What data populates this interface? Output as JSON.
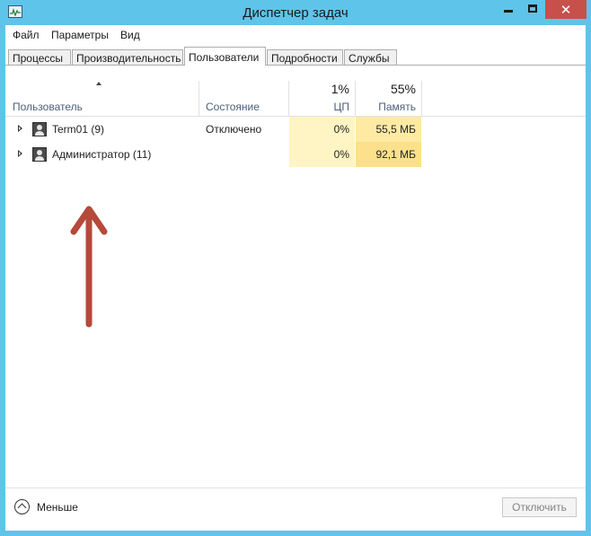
{
  "window": {
    "title": "Диспетчер задач",
    "close_glyph": "✕"
  },
  "menu": {
    "items": [
      "Файл",
      "Параметры",
      "Вид"
    ]
  },
  "tabs": [
    "Процессы",
    "Производительность",
    "Пользователи",
    "Подробности",
    "Службы"
  ],
  "active_tab": "Пользователи",
  "columns": {
    "user": "Пользователь",
    "status": "Состояние",
    "cpu_total": "1%",
    "cpu": "ЦП",
    "mem_total": "55%",
    "mem": "Память"
  },
  "rows": [
    {
      "name": "Term01 (9)",
      "status": "Отключено",
      "cpu": "0%",
      "memory": "55,5 МБ"
    },
    {
      "name": "Администратор (11)",
      "status": "",
      "cpu": "0%",
      "memory": "92,1 МБ"
    }
  ],
  "footer": {
    "less_label": "Меньше",
    "disconnect_label": "Отключить"
  },
  "colors": {
    "title_bar": "#5ec4ea",
    "close_button": "#c7504b",
    "annotation_arrow": "#b5493a",
    "cpu_cell": "#fff4c4",
    "mem_cell": "#ffeaa4"
  },
  "icons": {
    "app": "task-manager-icon",
    "user": "user-icon",
    "annotation": "arrow-up-icon"
  }
}
